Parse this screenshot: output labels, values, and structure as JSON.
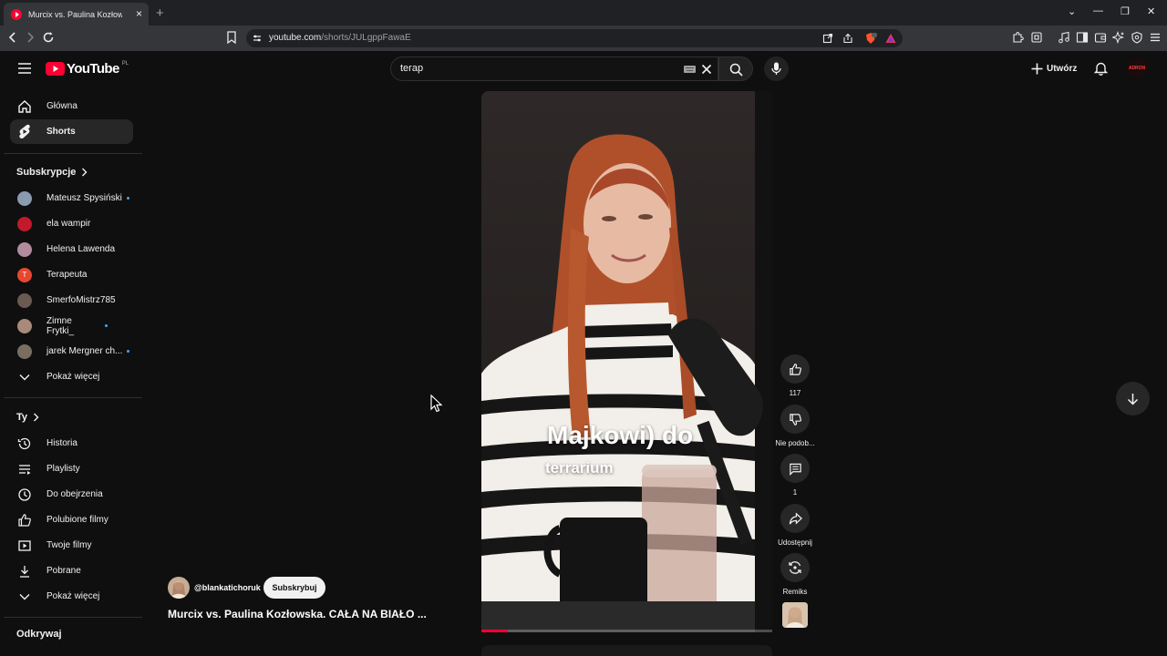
{
  "browser": {
    "tab_title": "Murcix vs. Paulina Kozłowska",
    "tab_close": "×",
    "new_tab": "+",
    "url_host": "youtube.com",
    "url_path": "/shorts/JULgppFawaE",
    "window_controls": [
      "⌄",
      "—",
      "❐",
      "✕"
    ]
  },
  "header": {
    "logo_text": "YouTube",
    "logo_region": "PL",
    "search_value": "terap",
    "create_label": "Utwórz",
    "avatar_text": "ADRON"
  },
  "sidebar": {
    "main": [
      {
        "label": "Główna",
        "icon": "home-icon"
      },
      {
        "label": "Shorts",
        "icon": "shorts-icon",
        "active": true
      }
    ],
    "subscriptions_title": "Subskrypcje",
    "subscriptions": [
      {
        "label": "Mateusz Spysiński",
        "color": "#8a9bb0",
        "new": true
      },
      {
        "label": "ela wampir",
        "color": "#c21a2b",
        "new": false
      },
      {
        "label": "Helena Lawenda",
        "color": "#b38b9e",
        "new": false
      },
      {
        "label": "Terapeuta",
        "color": "#e8472f",
        "new": false,
        "initial": "T"
      },
      {
        "label": "SmerfoMistrz785",
        "color": "#6b5a52",
        "new": false
      },
      {
        "label": "Zimne Frytki_",
        "color": "#a88a7a",
        "new": true
      },
      {
        "label": "jarek Mergner ch...",
        "color": "#7a6e63",
        "new": true
      }
    ],
    "show_more_1": "Pokaż więcej",
    "you_title": "Ty",
    "you_items": [
      {
        "label": "Historia",
        "icon": "history-icon"
      },
      {
        "label": "Playlisty",
        "icon": "playlist-icon"
      },
      {
        "label": "Do obejrzenia",
        "icon": "watch-later-icon"
      },
      {
        "label": "Polubione filmy",
        "icon": "like-icon"
      },
      {
        "label": "Twoje filmy",
        "icon": "your-videos-icon"
      },
      {
        "label": "Pobrane",
        "icon": "download-icon"
      }
    ],
    "show_more_2": "Pokaż więcej",
    "explore_title": "Odkrywaj"
  },
  "short": {
    "caption_line1": "Majkowi) do",
    "caption_line2": "terrarium",
    "progress": 0.09,
    "channel": "@blankatichoruk",
    "subscribe_label": "Subskrybuj",
    "title": "Murcix vs. Paulina Kozłowska. CAŁA NA BIAŁO ..."
  },
  "actions": {
    "likes": "117",
    "dislike_label": "Nie podob...",
    "comments": "1",
    "share_label": "Udostępnij",
    "remix_label": "Remiks"
  }
}
